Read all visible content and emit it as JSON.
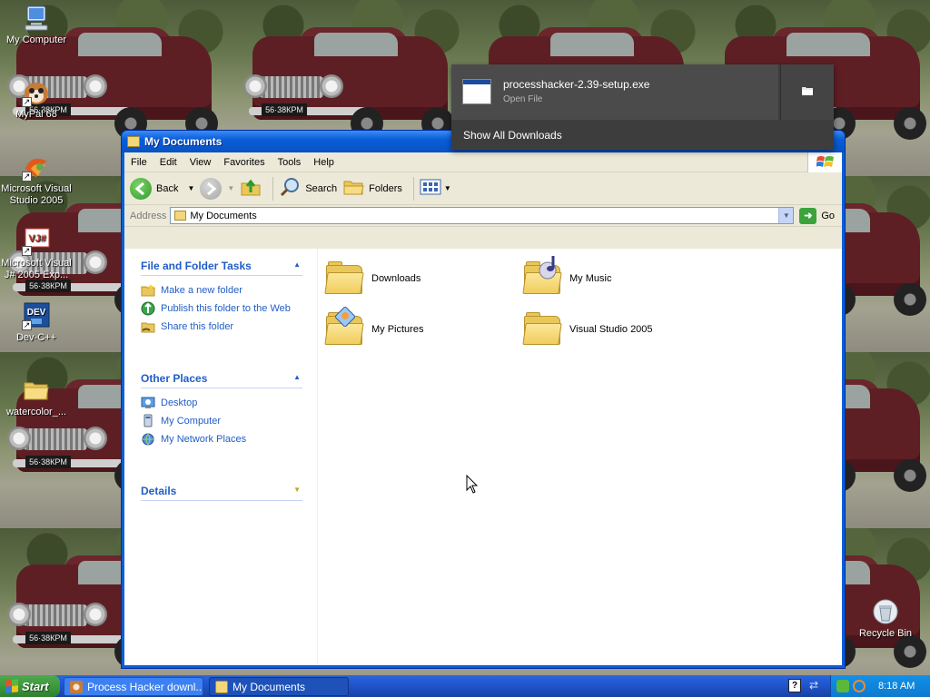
{
  "desktop": {
    "icons": [
      {
        "label": "My Computer",
        "icon": "my-computer-icon"
      },
      {
        "label": "MyPal 68",
        "icon": "mypal-icon"
      },
      {
        "label": "Microsoft Visual Studio 2005",
        "icon": "visual-studio-icon"
      },
      {
        "label": "Microsoft Visual J# 2005 Exp...",
        "icon": "visual-jsharp-icon"
      },
      {
        "label": "Dev-C++",
        "icon": "devcpp-icon"
      },
      {
        "label": "watercolor_...",
        "icon": "folder-icon"
      },
      {
        "label": "Recycle Bin",
        "icon": "recycle-bin-icon"
      }
    ],
    "plate_text": "56·38КРМ"
  },
  "downloads_popup": {
    "filename": "processhacker-2.39-setup.exe",
    "action": "Open File",
    "show_all": "Show All Downloads"
  },
  "window": {
    "title": "My Documents",
    "menu": [
      "File",
      "Edit",
      "View",
      "Favorites",
      "Tools",
      "Help"
    ],
    "toolbar": {
      "back": "Back",
      "search": "Search",
      "folders": "Folders"
    },
    "address": {
      "label": "Address",
      "value": "My Documents",
      "go": "Go"
    },
    "taskpane": {
      "file_folder_tasks": {
        "title": "File and Folder Tasks",
        "items": [
          "Make a new folder",
          "Publish this folder to the Web",
          "Share this folder"
        ]
      },
      "other_places": {
        "title": "Other Places",
        "items": [
          "Desktop",
          "My Computer",
          "My Network Places"
        ]
      },
      "details": {
        "title": "Details"
      }
    },
    "files": [
      "Downloads",
      "My Music",
      "My Pictures",
      "Visual Studio 2005"
    ]
  },
  "taskbar": {
    "start": "Start",
    "buttons": [
      "Process Hacker downl...",
      "My Documents"
    ],
    "clock": "8:18 AM"
  },
  "colors": {
    "xp_blue": "#0a5ed8",
    "link_blue": "#215dc6",
    "start_green": "#3c9a3c",
    "popup_bg": "#3d3d3d"
  }
}
